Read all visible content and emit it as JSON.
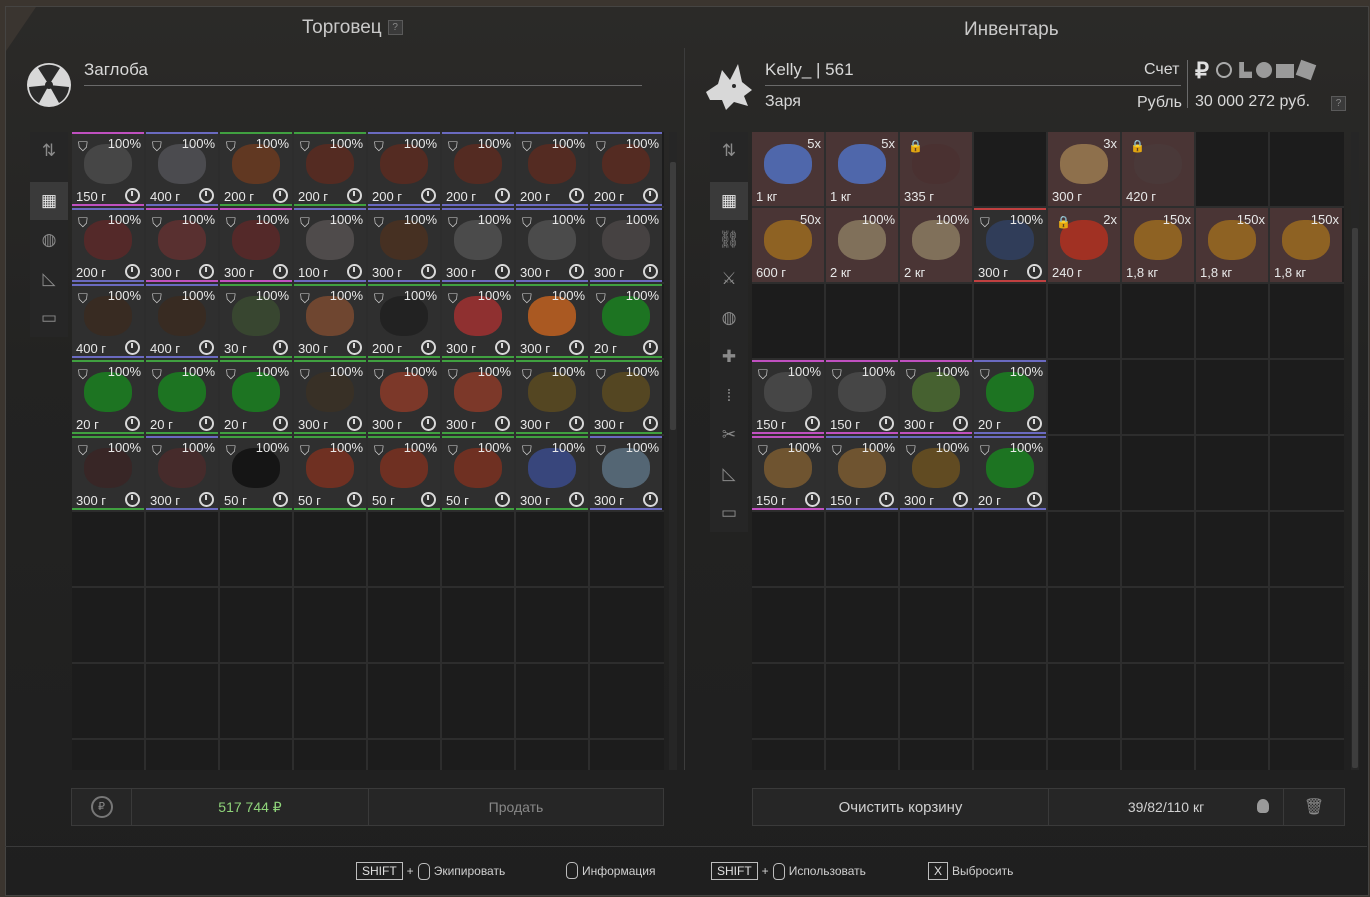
{
  "trader": {
    "title": "Торговец",
    "help": "?",
    "name": "Заглоба",
    "total": "517 744 ₽",
    "sell_label": "Продать",
    "items": [
      {
        "dur": "100%",
        "wt": "150 г",
        "c": "#4a4a4a",
        "bar": "#c050c0"
      },
      {
        "dur": "100%",
        "wt": "400 г",
        "c": "#505055",
        "bar": "#6a6ac0"
      },
      {
        "dur": "100%",
        "wt": "200 г",
        "c": "#6a3a20",
        "bar": "#40a040"
      },
      {
        "dur": "100%",
        "wt": "200 г",
        "c": "#5a2a20",
        "bar": "#40a040"
      },
      {
        "dur": "100%",
        "wt": "200 г",
        "c": "#5a2a20",
        "bar": "#6a6ac0"
      },
      {
        "dur": "100%",
        "wt": "200 г",
        "c": "#5a2a20",
        "bar": "#6a6ac0"
      },
      {
        "dur": "100%",
        "wt": "200 г",
        "c": "#5a2a20",
        "bar": "#6a6ac0"
      },
      {
        "dur": "100%",
        "wt": "200 г",
        "c": "#5a2a20",
        "bar": "#6a6ac0"
      },
      {
        "dur": "100%",
        "wt": "200 г",
        "c": "#5a2828",
        "bar": "#6a6ac0"
      },
      {
        "dur": "100%",
        "wt": "300 г",
        "c": "#603030",
        "bar": "#c050c0"
      },
      {
        "dur": "100%",
        "wt": "300 г",
        "c": "#5a2828",
        "bar": "#c050c0"
      },
      {
        "dur": "100%",
        "wt": "100 г",
        "c": "#555050",
        "bar": "#6a6ac0"
      },
      {
        "dur": "100%",
        "wt": "300 г",
        "c": "#4a3020",
        "bar": "#6a6ac0"
      },
      {
        "dur": "100%",
        "wt": "300 г",
        "c": "#505050",
        "bar": "#6a6ac0"
      },
      {
        "dur": "100%",
        "wt": "300 г",
        "c": "#505050",
        "bar": "#6a6ac0"
      },
      {
        "dur": "100%",
        "wt": "300 г",
        "c": "#4a4545",
        "bar": "#6a6ac0"
      },
      {
        "dur": "100%",
        "wt": "400 г",
        "c": "#3a2a20",
        "bar": "#6a6ac0"
      },
      {
        "dur": "100%",
        "wt": "400 г",
        "c": "#3a2a20",
        "bar": "#6a6ac0"
      },
      {
        "dur": "100%",
        "wt": "30 г",
        "c": "#3a4a30",
        "bar": "#40a040"
      },
      {
        "dur": "100%",
        "wt": "300 г",
        "c": "#7a4a30",
        "bar": "#40a040"
      },
      {
        "dur": "100%",
        "wt": "200 г",
        "c": "#202020",
        "bar": "#40a040"
      },
      {
        "dur": "100%",
        "wt": "300 г",
        "c": "#a03030",
        "bar": "#40a040"
      },
      {
        "dur": "100%",
        "wt": "300 г",
        "c": "#c06020",
        "bar": "#40a040"
      },
      {
        "dur": "100%",
        "wt": "20 г",
        "c": "#1a8020",
        "bar": "#40a040"
      },
      {
        "dur": "100%",
        "wt": "20 г",
        "c": "#1a8020",
        "bar": "#40a040"
      },
      {
        "dur": "100%",
        "wt": "20 г",
        "c": "#1a8020",
        "bar": "#40a040"
      },
      {
        "dur": "100%",
        "wt": "20 г",
        "c": "#1a8020",
        "bar": "#40a040"
      },
      {
        "dur": "100%",
        "wt": "300 г",
        "c": "#3a3025",
        "bar": "#40a040"
      },
      {
        "dur": "100%",
        "wt": "300 г",
        "c": "#8a3a28",
        "bar": "#40a040"
      },
      {
        "dur": "100%",
        "wt": "300 г",
        "c": "#8a3a28",
        "bar": "#40a040"
      },
      {
        "dur": "100%",
        "wt": "300 г",
        "c": "#5a4a20",
        "bar": "#40a040"
      },
      {
        "dur": "100%",
        "wt": "300 г",
        "c": "#5a4a20",
        "bar": "#40a040"
      },
      {
        "dur": "100%",
        "wt": "300 г",
        "c": "#3a2525",
        "bar": "#40a040"
      },
      {
        "dur": "100%",
        "wt": "300 г",
        "c": "#4a2a2a",
        "bar": "#6a6ac0"
      },
      {
        "dur": "100%",
        "wt": "50 г",
        "c": "#101010",
        "bar": "#40a040"
      },
      {
        "dur": "100%",
        "wt": "50 г",
        "c": "#7a3020",
        "bar": "#40a040"
      },
      {
        "dur": "100%",
        "wt": "50 г",
        "c": "#7a3020",
        "bar": "#40a040"
      },
      {
        "dur": "100%",
        "wt": "50 г",
        "c": "#7a3020",
        "bar": "#40a040"
      },
      {
        "dur": "100%",
        "wt": "300 г",
        "c": "#3a4a8a",
        "bar": "#40a040"
      },
      {
        "dur": "100%",
        "wt": "300 г",
        "c": "#5a7080",
        "bar": "#6a6ac0"
      }
    ]
  },
  "inventory": {
    "title": "Инвентарь",
    "player": "Kelly_ | 561",
    "faction": "Заря",
    "account_label": "Счет",
    "currency_label": "Рубль",
    "currency_symbol": "₽",
    "balance": "30 000 272 руб.",
    "help": "?",
    "clear_label": "Очистить корзину",
    "weight": "39/82/110 кг",
    "items_top": [
      {
        "count": "5x",
        "wt": "1 кг",
        "c": "#5070c0",
        "red": true
      },
      {
        "count": "5x",
        "wt": "1 кг",
        "c": "#5070c0",
        "red": true
      },
      {
        "count": "",
        "wt": "335 г",
        "c": "#4a3030",
        "red": true,
        "lock": true
      },
      {
        "count": "",
        "wt": "",
        "c": "",
        "red": false,
        "empty": true
      },
      {
        "count": "3x",
        "wt": "300 г",
        "c": "#9a7a50",
        "red": true
      },
      {
        "count": "",
        "wt": "420 г",
        "c": "#4a3a3a",
        "red": true,
        "lock": true
      },
      {
        "count": "",
        "wt": "",
        "c": "",
        "red": false,
        "empty": true
      },
      {
        "count": "",
        "wt": "",
        "c": "",
        "red": false,
        "empty": true
      },
      {
        "count": "50x",
        "wt": "600 г",
        "c": "#9a6a20",
        "red": true
      },
      {
        "count": "100%",
        "wt": "2 кг",
        "c": "#8a7a60",
        "red": true
      },
      {
        "count": "100%",
        "wt": "2 кг",
        "c": "#8a7a60",
        "red": true
      },
      {
        "count": "100%",
        "wt": "300 г",
        "c": "#304060",
        "red": false,
        "shield": true,
        "bar": "#c04040"
      },
      {
        "count": "2x",
        "wt": "240 г",
        "c": "#b03020",
        "red": true,
        "lock": true
      },
      {
        "count": "150x",
        "wt": "1,8 кг",
        "c": "#9a6a20",
        "red": true
      },
      {
        "count": "150x",
        "wt": "1,8 кг",
        "c": "#9a6a20",
        "red": true
      },
      {
        "count": "150x",
        "wt": "1,8 кг",
        "c": "#9a6a20",
        "red": true
      }
    ],
    "items_bottom": [
      {
        "dur": "100%",
        "wt": "150 г",
        "c": "#4a4a4a",
        "bar": "#c050c0"
      },
      {
        "dur": "100%",
        "wt": "150 г",
        "c": "#4a4a4a",
        "bar": "#c050c0"
      },
      {
        "dur": "100%",
        "wt": "300 г",
        "c": "#4a6a30",
        "bar": "#c050c0"
      },
      {
        "dur": "100%",
        "wt": "20 г",
        "c": "#1a8020",
        "bar": "#6a6ac0"
      },
      {
        "dur": "100%",
        "wt": "150 г",
        "c": "#7a5a30",
        "bar": "#c050c0"
      },
      {
        "dur": "100%",
        "wt": "150 г",
        "c": "#7a5a30",
        "bar": "#6a6ac0"
      },
      {
        "dur": "100%",
        "wt": "300 г",
        "c": "#6a5020",
        "bar": "#6a6ac0"
      },
      {
        "dur": "100%",
        "wt": "20 г",
        "c": "#1a8020",
        "bar": "#6a6ac0"
      }
    ]
  },
  "hints": {
    "shift": "SHIFT",
    "plus": "+",
    "equip": "Экипировать",
    "info": "Информация",
    "use": "Использовать",
    "x_key": "X",
    "drop": "Выбросить"
  }
}
